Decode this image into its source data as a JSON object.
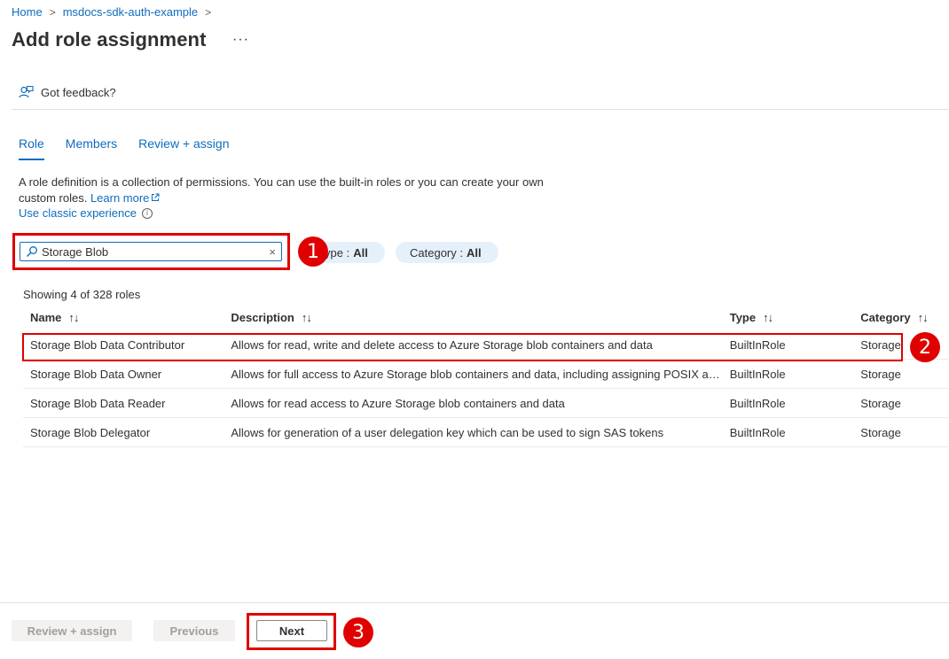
{
  "breadcrumb": {
    "home": "Home",
    "resource": "msdocs-sdk-auth-example",
    "sep": ">"
  },
  "page": {
    "title": "Add role assignment",
    "more": "···"
  },
  "feedback": {
    "label": "Got feedback?"
  },
  "tabs": [
    {
      "label": "Role"
    },
    {
      "label": "Members"
    },
    {
      "label": "Review + assign"
    }
  ],
  "description": {
    "text": "A role definition is a collection of permissions. You can use the built-in roles or you can create your own custom roles.",
    "learn_more": "Learn more",
    "classic": "Use classic experience",
    "info": "i"
  },
  "search": {
    "value": "Storage Blob",
    "clear": "×"
  },
  "filters": {
    "type_label": "ype :",
    "type_value": "All",
    "category_label": "Category :",
    "category_value": "All"
  },
  "results": {
    "showing": "Showing 4 of 328 roles"
  },
  "table": {
    "headers": {
      "name": "Name",
      "description": "Description",
      "type": "Type",
      "category": "Category"
    },
    "sort": "↑↓",
    "rows": [
      {
        "name": "Storage Blob Data Contributor",
        "description": "Allows for read, write and delete access to Azure Storage blob containers and data",
        "type": "BuiltInRole",
        "category": "Storage"
      },
      {
        "name": "Storage Blob Data Owner",
        "description": "Allows for full access to Azure Storage blob containers and data, including assigning POSIX access control.",
        "type": "BuiltInRole",
        "category": "Storage"
      },
      {
        "name": "Storage Blob Data Reader",
        "description": "Allows for read access to Azure Storage blob containers and data",
        "type": "BuiltInRole",
        "category": "Storage"
      },
      {
        "name": "Storage Blob Delegator",
        "description": "Allows for generation of a user delegation key which can be used to sign SAS tokens",
        "type": "BuiltInRole",
        "category": "Storage"
      }
    ]
  },
  "footer": {
    "review": "Review + assign",
    "previous": "Previous",
    "next": "Next"
  },
  "annotations": {
    "one": "1",
    "two": "2",
    "three": "3"
  },
  "colors": {
    "accent": "#0f6cbd",
    "annotation": "#e00000",
    "pill": "#e6f0fa"
  }
}
